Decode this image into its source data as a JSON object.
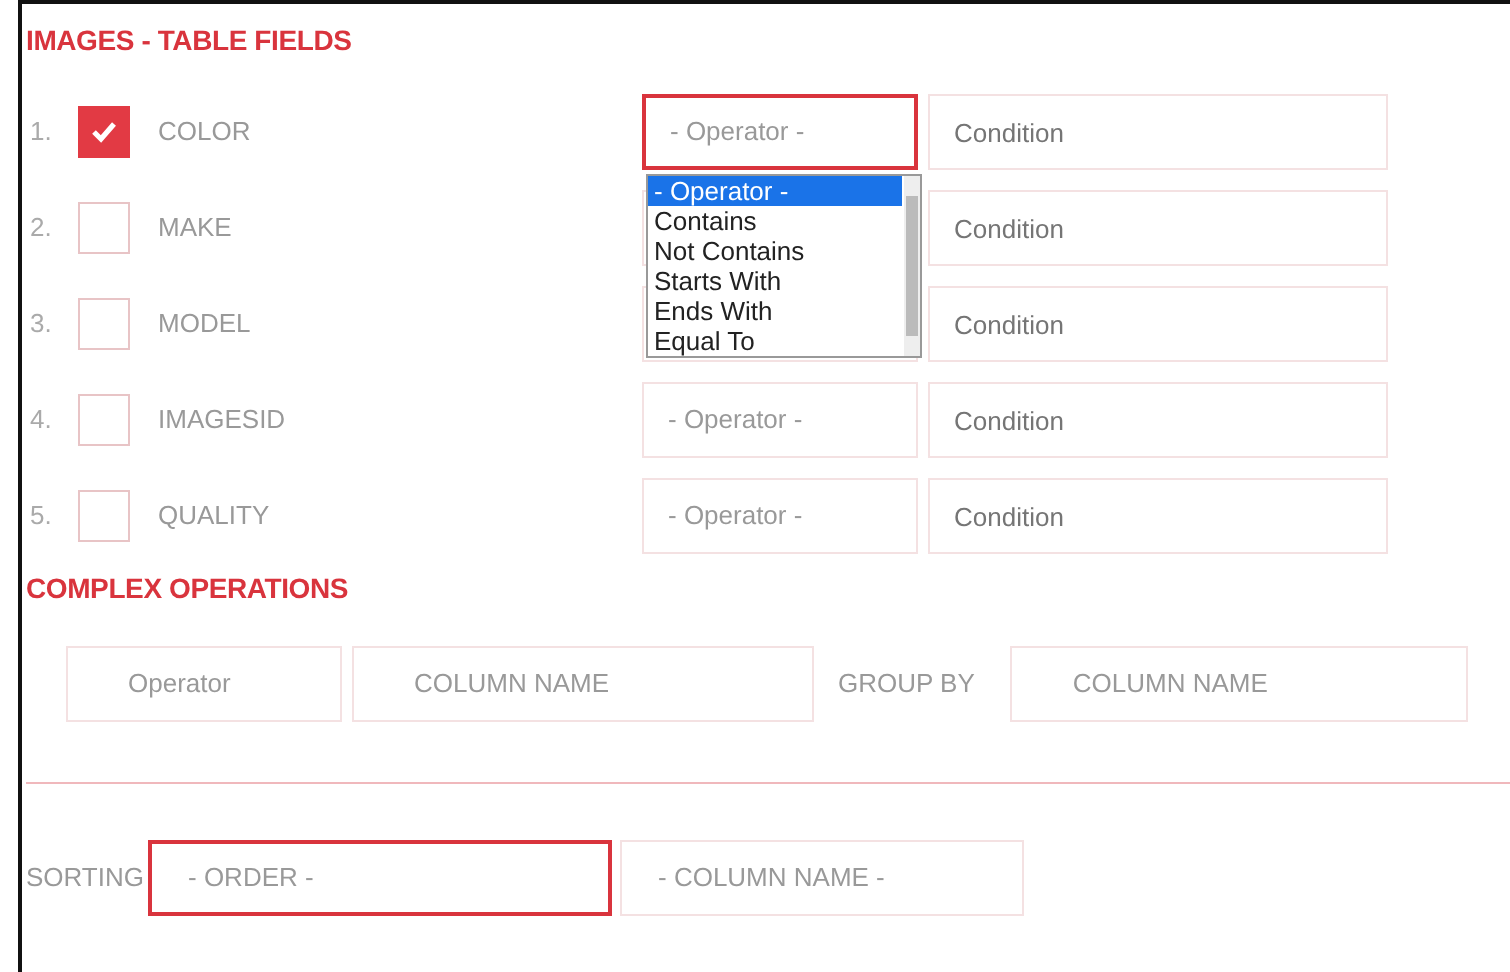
{
  "section_title": "IMAGES - TABLE FIELDS",
  "fields": [
    {
      "number": "1.",
      "label": "COLOR",
      "checked": true,
      "operator": "- Operator -",
      "focused": true,
      "condition_placeholder": "Condition"
    },
    {
      "number": "2.",
      "label": "MAKE",
      "checked": false,
      "condition_placeholder": "Condition"
    },
    {
      "number": "3.",
      "label": "MODEL",
      "checked": false,
      "condition_placeholder": "Condition"
    },
    {
      "number": "4.",
      "label": "IMAGESID",
      "checked": false,
      "operator": "- Operator -",
      "focused": false,
      "condition_placeholder": "Condition"
    },
    {
      "number": "5.",
      "label": "QUALITY",
      "checked": false,
      "operator": "- Operator -",
      "focused": false,
      "condition_placeholder": "Condition"
    }
  ],
  "operator_dropdown": {
    "options": [
      {
        "label": "- Operator -",
        "selected": true
      },
      {
        "label": "Contains",
        "selected": false
      },
      {
        "label": "Not Contains",
        "selected": false
      },
      {
        "label": "Starts With",
        "selected": false
      },
      {
        "label": "Ends With",
        "selected": false
      },
      {
        "label": "Equal To",
        "selected": false
      }
    ]
  },
  "complex_title": "COMPLEX OPERATIONS",
  "complex": {
    "operator": "Operator",
    "column": "COLUMN NAME",
    "group_by_label": "GROUP BY",
    "group_column": "COLUMN NAME"
  },
  "sorting": {
    "label": "SORTING",
    "order": "- ORDER -",
    "order_focused": true,
    "column": "- COLUMN NAME -"
  }
}
